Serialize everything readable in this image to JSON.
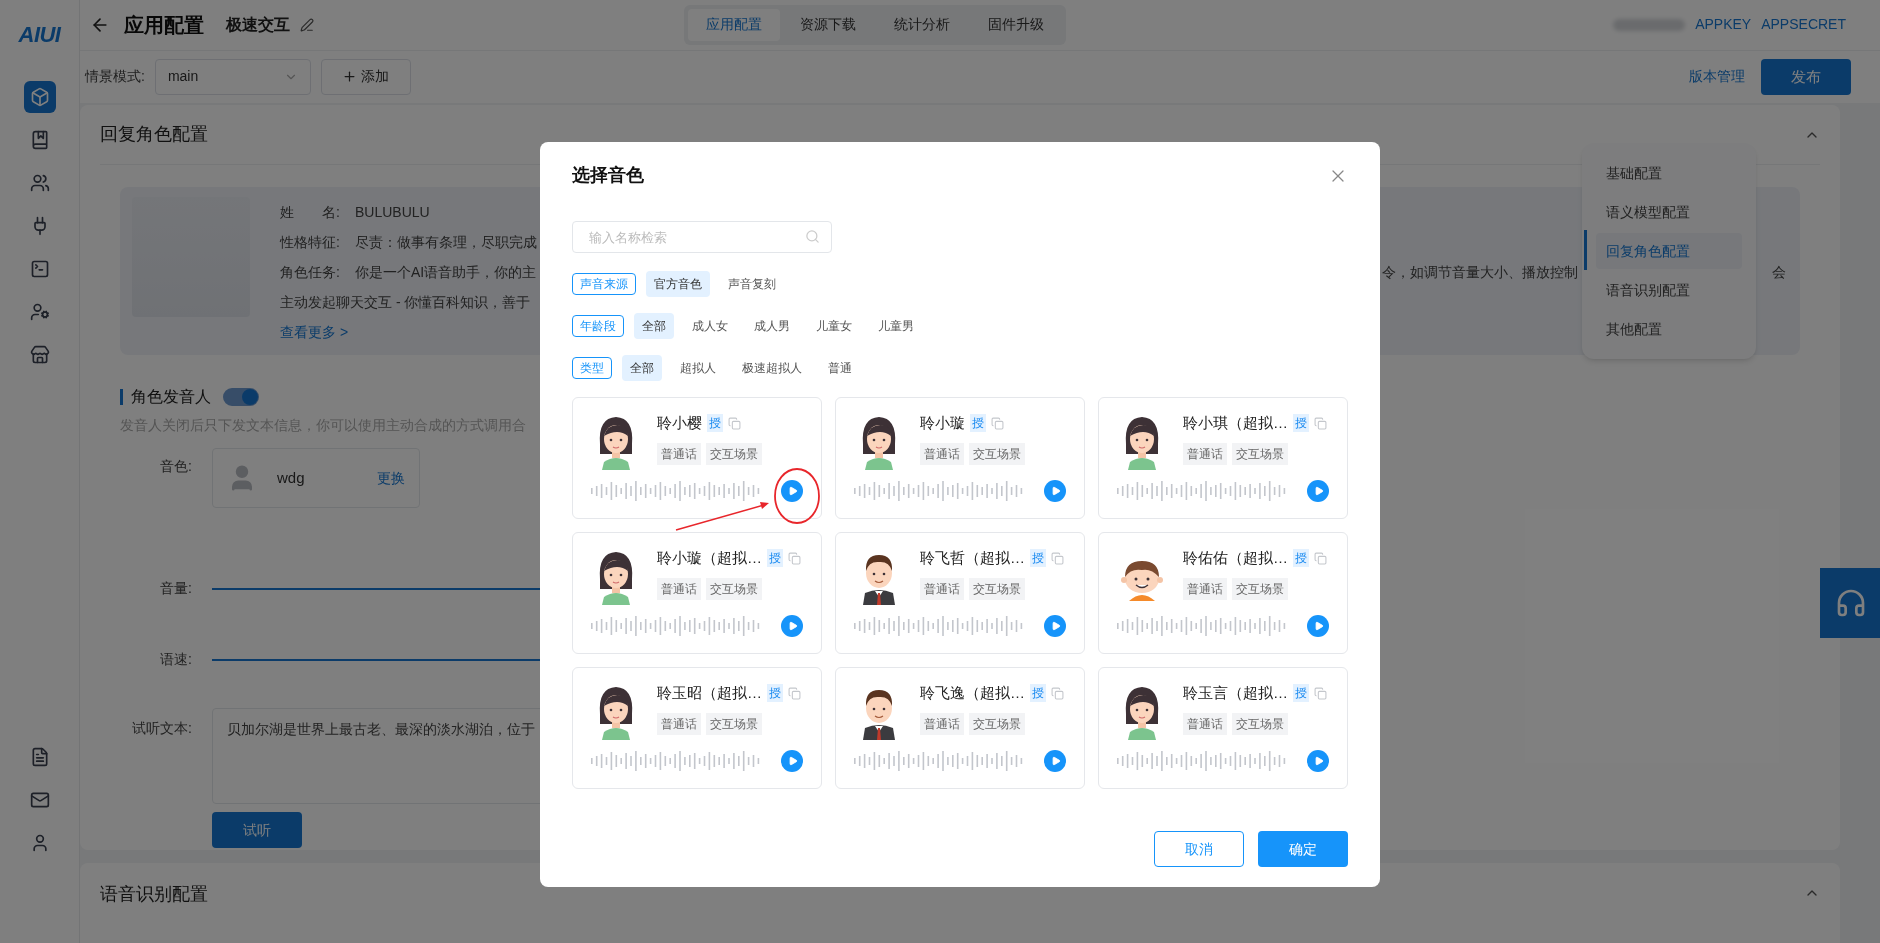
{
  "sidebar": {
    "logo": "AIUI",
    "items": [
      {
        "selected": true
      },
      {
        "selected": false
      },
      {
        "selected": false
      },
      {
        "selected": false
      },
      {
        "selected": false
      },
      {
        "selected": false
      },
      {
        "selected": false
      }
    ],
    "bottom_items": [
      {
        "selected": false
      },
      {
        "selected": false
      },
      {
        "selected": false
      }
    ]
  },
  "header": {
    "title": "应用配置",
    "app_name": "极速交互",
    "tabs": [
      {
        "label": "应用配置",
        "selected": true
      },
      {
        "label": "资源下载",
        "selected": false
      },
      {
        "label": "统计分析",
        "selected": false
      },
      {
        "label": "固件升级",
        "selected": false
      }
    ],
    "links": [
      "APPKEY",
      "APPSECRET"
    ]
  },
  "toolbar": {
    "scene_label": "情景模式:",
    "scene_value": "main",
    "add_button": "添加",
    "version_link": "版本管理",
    "publish_button": "发布"
  },
  "role_card": {
    "title": "回复角色配置",
    "expanded": true,
    "profile": {
      "rows": [
        {
          "label": "姓　　名:",
          "value": "BULUBULU"
        },
        {
          "label": "性格特征:",
          "value": "尽责：做事有条理，尽职完成"
        },
        {
          "label": "角色任务:",
          "value": "你是一个AI语音助手，你的主",
          "fragments": [
            "令，如调节音量大小、播放控制",
            "会"
          ]
        },
        {
          "value": "主动发起聊天交互 - 你懂百科知识，善于"
        }
      ],
      "more_link": "查看更多 >"
    },
    "speaker": {
      "label": "角色发音人",
      "on": true,
      "hint": "发音人关闭后只下发文本信息，你可以使用主动合成的方式调用合"
    },
    "voice": {
      "label": "音色:",
      "name": "wdg",
      "change_link": "更换"
    },
    "volume": {
      "label": "音量:"
    },
    "speed": {
      "label": "语速:"
    },
    "preview": {
      "label": "试听文本:",
      "text": "贝加尔湖是世界上最古老、最深的淡水湖泊，位于",
      "button": "试听"
    }
  },
  "section_nav": [
    {
      "label": "基础配置",
      "selected": false
    },
    {
      "label": "语义模型配置",
      "selected": false
    },
    {
      "label": "回复角色配置",
      "selected": true
    },
    {
      "label": "语音识别配置",
      "selected": false
    },
    {
      "label": "其他配置",
      "selected": false
    }
  ],
  "second_card": {
    "title": "语音识别配置",
    "expanded": true
  },
  "modal": {
    "title": "选择音色",
    "search": {
      "placeholder": "输入名称检索"
    },
    "filters": [
      {
        "label": "声音来源",
        "options": [
          {
            "label": "官方音色",
            "selected": true
          },
          {
            "label": "声音复刻",
            "selected": false
          }
        ]
      },
      {
        "label": "年龄段",
        "options": [
          {
            "label": "全部",
            "selected": true
          },
          {
            "label": "成人女",
            "selected": false
          },
          {
            "label": "成人男",
            "selected": false
          },
          {
            "label": "儿童女",
            "selected": false
          },
          {
            "label": "儿童男",
            "selected": false
          }
        ]
      },
      {
        "label": "类型",
        "options": [
          {
            "label": "全部",
            "selected": true
          },
          {
            "label": "超拟人",
            "selected": false
          },
          {
            "label": "极速超拟人",
            "selected": false
          },
          {
            "label": "普通",
            "selected": false
          }
        ]
      }
    ],
    "voices": [
      {
        "name": "聆小樱",
        "kind": "woman",
        "badge": "授",
        "tags": [
          "普通话",
          "交互场景"
        ],
        "highlighted": true
      },
      {
        "name": "聆小璇",
        "kind": "woman",
        "badge": "授",
        "tags": [
          "普通话",
          "交互场景"
        ],
        "highlighted": false
      },
      {
        "name": "聆小琪（超拟…",
        "kind": "woman",
        "badge": "授",
        "tags": [
          "普通话",
          "交互场景"
        ],
        "highlighted": false
      },
      {
        "name": "聆小璇（超拟…",
        "kind": "woman",
        "badge": "授",
        "tags": [
          "普通话",
          "交互场景"
        ],
        "highlighted": false
      },
      {
        "name": "聆飞哲（超拟…",
        "kind": "man",
        "badge": "授",
        "tags": [
          "普通话",
          "交互场景"
        ],
        "highlighted": false
      },
      {
        "name": "聆佑佑（超拟…",
        "kind": "boy",
        "badge": "授",
        "tags": [
          "普通话",
          "交互场景"
        ],
        "highlighted": false
      },
      {
        "name": "聆玉昭（超拟…",
        "kind": "woman",
        "badge": "授",
        "tags": [
          "普通话",
          "交互场景"
        ],
        "highlighted": false
      },
      {
        "name": "聆飞逸（超拟…",
        "kind": "man",
        "badge": "授",
        "tags": [
          "普通话",
          "交互场景"
        ],
        "highlighted": false
      },
      {
        "name": "聆玉言（超拟…",
        "kind": "woman",
        "badge": "授",
        "tags": [
          "普通话",
          "交互场景"
        ],
        "highlighted": false
      }
    ],
    "cancel_button": "取消",
    "confirm_button": "确定"
  }
}
